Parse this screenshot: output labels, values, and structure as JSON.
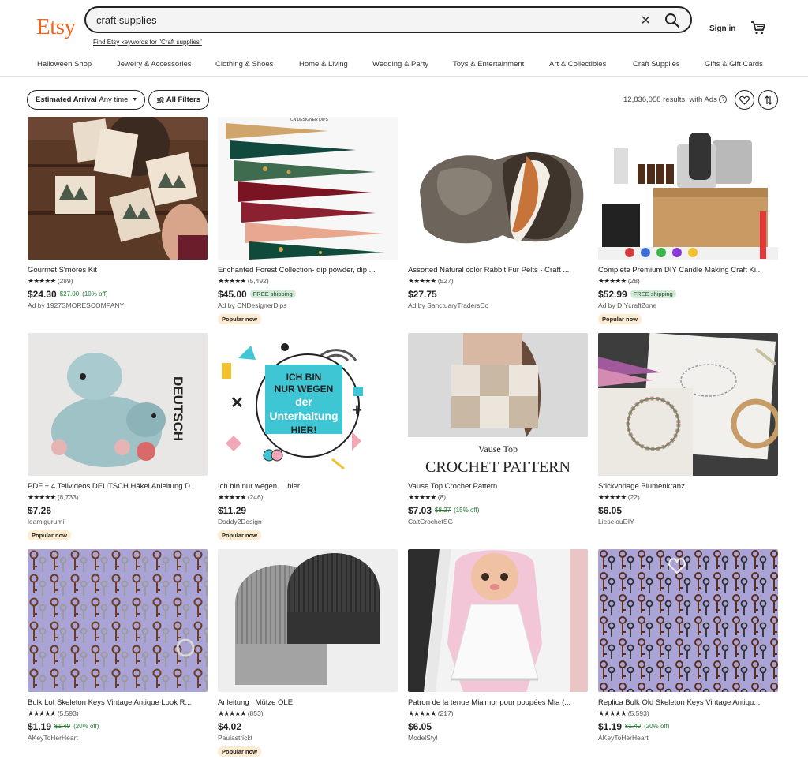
{
  "brand": "Etsy",
  "search": {
    "query": "craft supplies",
    "suggestion": "Find Etsy keywords for \"Craft supplies\""
  },
  "header": {
    "signin": "Sign in"
  },
  "categories": [
    "Halloween Shop",
    "Jewelry & Accessories",
    "Clothing & Shoes",
    "Home & Living",
    "Wedding & Party",
    "Toys & Entertainment",
    "Art & Collectibles",
    "Craft Supplies",
    "Gifts & Gift Cards"
  ],
  "filters": {
    "arrival_label": "Estimated Arrival",
    "arrival_value": "Any time",
    "all_filters": "All Filters"
  },
  "results_text": "12,836,058 results, with Ads",
  "stars": "★★★★★",
  "listings": [
    {
      "title": "Gourmet S'mores Kit",
      "reviews": "(289)",
      "price": "$24.30",
      "original": "$27.00",
      "discount": "(10% off)",
      "shipping": "",
      "seller": "Ad by 1927SMORESCOMPANY",
      "badge": ""
    },
    {
      "title": "Enchanted Forest Collection- dip powder, dip ...",
      "reviews": "(5,492)",
      "price": "$45.00",
      "original": "",
      "discount": "",
      "shipping": "FREE shipping",
      "seller": "Ad by CNDesignerDips",
      "badge": "Popular now"
    },
    {
      "title": "Assorted Natural color Rabbit Fur Pelts - Craft ...",
      "reviews": "(527)",
      "price": "$27.75",
      "original": "",
      "discount": "",
      "shipping": "",
      "seller": "Ad by SanctuaryTradersCo",
      "badge": ""
    },
    {
      "title": "Complete Premium DIY Candle Making Craft Ki...",
      "reviews": "(28)",
      "price": "$52.99",
      "original": "",
      "discount": "",
      "shipping": "FREE shipping",
      "seller": "Ad by DIYcraftZone",
      "badge": "Popular now"
    },
    {
      "title": "PDF + 4 Teilvideos DEUTSCH Häkel Anleitung D...",
      "reviews": "(8,733)",
      "price": "$7.26",
      "original": "",
      "discount": "",
      "shipping": "",
      "seller": "leamigurumi",
      "badge": "Popular now"
    },
    {
      "title": "Ich bin nur wegen ... hier",
      "reviews": "(246)",
      "price": "$11.29",
      "original": "",
      "discount": "",
      "shipping": "",
      "seller": "Daddy2Design",
      "badge": "Popular now"
    },
    {
      "title": "Vause Top Crochet Pattern",
      "reviews": "(8)",
      "price": "$7.03",
      "original": "$8.27",
      "discount": "(15% off)",
      "shipping": "",
      "seller": "CaitCrochetSG",
      "badge": ""
    },
    {
      "title": "Stickvorlage Blumenkranz",
      "reviews": "(22)",
      "price": "$6.05",
      "original": "",
      "discount": "",
      "shipping": "",
      "seller": "LieselouDIY",
      "badge": ""
    },
    {
      "title": "Bulk Lot Skeleton Keys Vintage Antique Look R...",
      "reviews": "(5,593)",
      "price": "$1.19",
      "original": "$1.49",
      "discount": "(20% off)",
      "shipping": "",
      "seller": "AKeyToHerHeart",
      "badge": ""
    },
    {
      "title": "Anleitung I Mütze OLE",
      "reviews": "(853)",
      "price": "$4.02",
      "original": "",
      "discount": "",
      "shipping": "",
      "seller": "Paulastrickt",
      "badge": "Popular now"
    },
    {
      "title": "Patron de la tenue Mia'mor pour poupées Mia (...",
      "reviews": "(217)",
      "price": "$6.05",
      "original": "",
      "discount": "",
      "shipping": "",
      "seller": "ModelStyl",
      "badge": ""
    },
    {
      "title": "Replica Bulk Old Skeleton Keys Vintage Antiqu...",
      "reviews": "(5,593)",
      "price": "$1.19",
      "original": "$1.49",
      "discount": "(20% off)",
      "shipping": "",
      "seller": "AKeyToHerHeart",
      "badge": ""
    }
  ],
  "image_text": {
    "nails_caption": "CN DESIGNER DIPS",
    "dino_label": "DEUTSCH",
    "quote": [
      "ICH BIN",
      "NUR WEGEN",
      "der",
      "Unterhaltung",
      "HIER!"
    ],
    "crochet_small": "Vause Top",
    "crochet_big": "CROCHET PATTERN"
  },
  "colors": {
    "brand": "#f1641e",
    "discount": "#2b7c3b",
    "free_shipping_bg": "#d4e9d7",
    "popular_bg": "#fdebd2"
  }
}
